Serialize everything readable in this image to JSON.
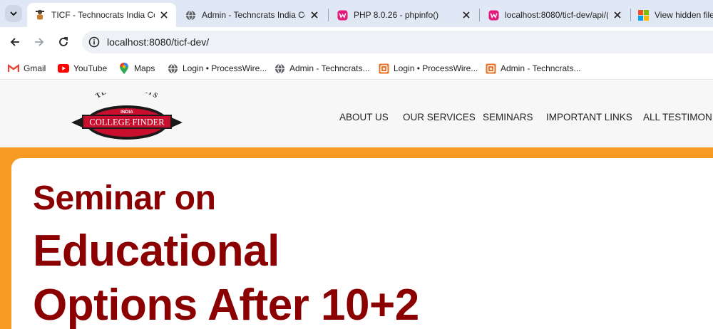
{
  "browser": {
    "tabs": [
      {
        "title": "TICF - Technocrats India Coll",
        "icon": "ticf-favicon-icon",
        "active": true
      },
      {
        "title": "Admin - Techncrats India Co",
        "icon": "globe-icon",
        "active": false
      },
      {
        "title": "PHP 8.0.26 - phpinfo()",
        "icon": "wamp-icon",
        "active": false
      },
      {
        "title": "localhost:8080/ticf-dev/api/(",
        "icon": "wamp-icon",
        "active": false
      },
      {
        "title": "View hidden files",
        "icon": "windows-icon",
        "active": false
      }
    ],
    "address": "localhost:8080/ticf-dev/",
    "bookmarks": [
      {
        "label": "Gmail",
        "icon": "gmail-icon"
      },
      {
        "label": "YouTube",
        "icon": "youtube-icon"
      },
      {
        "label": "Maps",
        "icon": "maps-icon"
      },
      {
        "label": "Login • ProcessWire...",
        "icon": "globe-icon"
      },
      {
        "label": "Admin - Techncrats...",
        "icon": "globe-icon"
      },
      {
        "label": "Login • ProcessWire...",
        "icon": "processwire-icon"
      },
      {
        "label": "Admin - Techncrats...",
        "icon": "processwire-icon"
      }
    ]
  },
  "site": {
    "logo": {
      "top_text": "TECHNOCRATS",
      "middle_text": "INDIA",
      "main_text": "COLLEGE FINDER"
    },
    "nav": [
      "ABOUT US",
      "OUR SERVICES",
      "SEMINARS",
      "IMPORTANT LINKS",
      "ALL TESTIMONIALS"
    ],
    "hero": {
      "line1": "Seminar on",
      "line2": "Educational",
      "line3": "Options After 10+2"
    },
    "colors": {
      "accent_orange": "#f79a22",
      "title_red": "#8b0000",
      "logo_red": "#c8102e"
    }
  }
}
